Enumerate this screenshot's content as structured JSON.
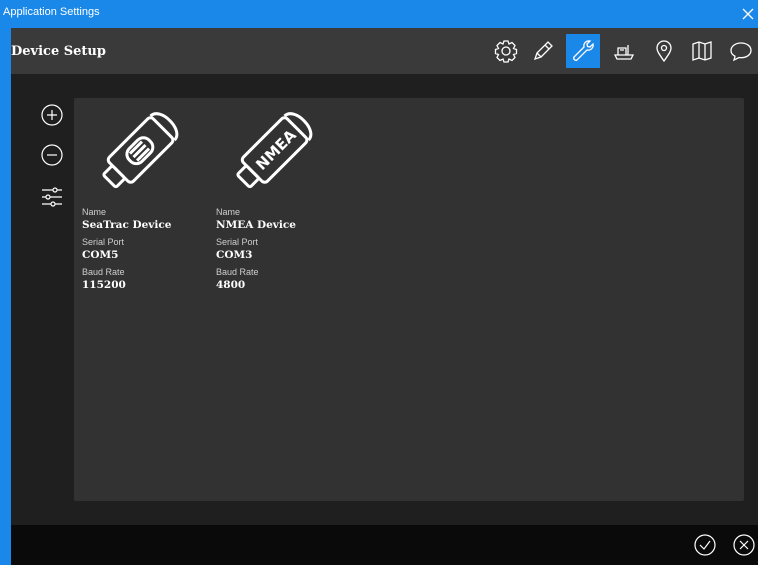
{
  "window": {
    "title": "Application Settings"
  },
  "header": {
    "title": "Device Setup"
  },
  "toolbar": {
    "icons": [
      "gear-icon",
      "pen-icon",
      "wrench-icon",
      "vessel-icon",
      "location-pin-icon",
      "map-icon",
      "chat-icon"
    ],
    "active": "wrench-icon"
  },
  "devices": [
    {
      "name_label": "Name",
      "name": "SeaTrac Device",
      "port_label": "Serial Port",
      "port": "COM5",
      "baud_label": "Baud Rate",
      "baud": "115200"
    },
    {
      "name_label": "Name",
      "name": "NMEA Device",
      "port_label": "Serial Port",
      "port": "COM3",
      "baud_label": "Baud Rate",
      "baud": "4800",
      "badge_text": "NMEA"
    }
  ],
  "colors": {
    "accent": "#1a88e8",
    "panel": "#323232",
    "header": "#3a3a3a"
  }
}
